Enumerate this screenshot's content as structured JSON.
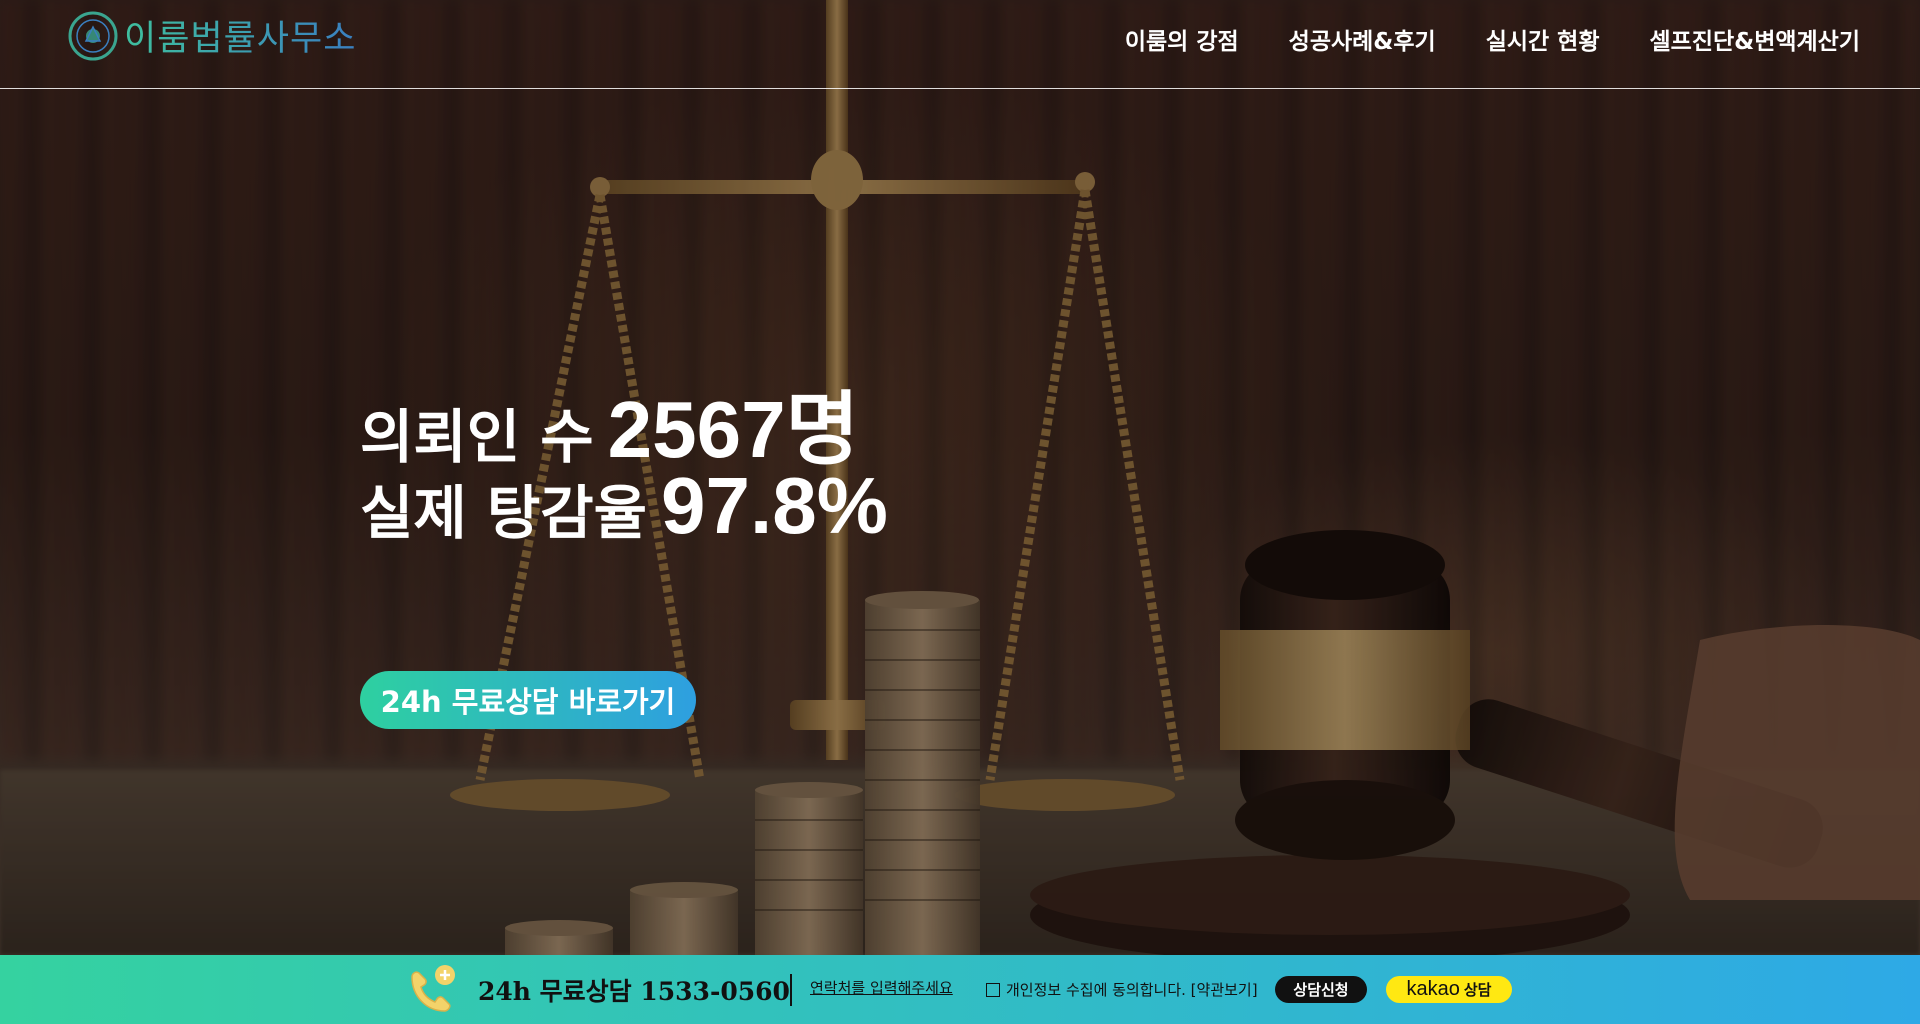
{
  "brand": {
    "name": "이룸법률사무소"
  },
  "nav": {
    "items": [
      "이룸의 강점",
      "성공사례&후기",
      "실시간 현황",
      "셀프진단&변액계산기"
    ]
  },
  "hero": {
    "line1": {
      "label": "의뢰인 수",
      "value": "2567명"
    },
    "line2": {
      "label": "실제 탕감율",
      "value": "97.8%"
    },
    "cta_label": "24h 무료상담 바로가기"
  },
  "bottom_bar": {
    "title": "24h 무료상담 1533-0560",
    "contact_placeholder": "연락처를 입력해주세요",
    "consent_text": "개인정보 수집에 동의합니다. [약관보기]",
    "consult_button": "상담신청",
    "kakao_word": "kakao",
    "kakao_suffix": "상담"
  },
  "colors": {
    "accent_start": "#2ed0a0",
    "accent_end": "#2e9fe0",
    "kakao": "#ffe812"
  }
}
